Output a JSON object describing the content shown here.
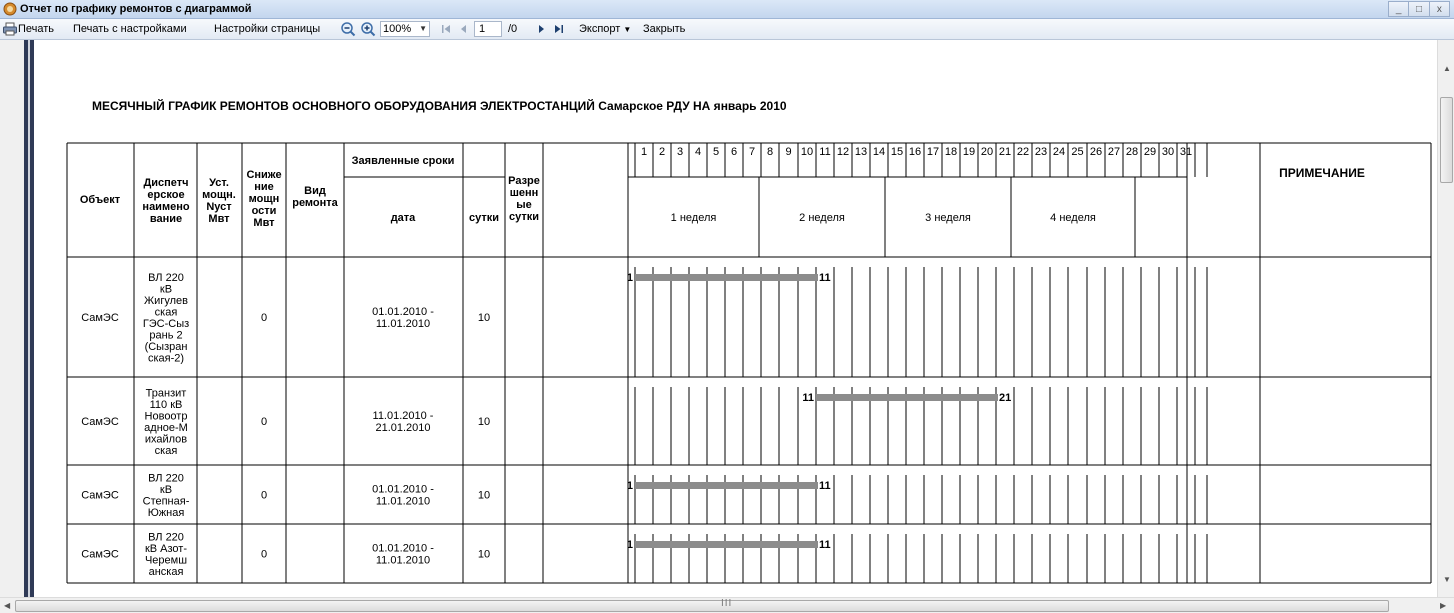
{
  "window": {
    "title": "Отчет по графику ремонтов с диаграммой",
    "controls": [
      "_",
      "□",
      "x"
    ]
  },
  "toolbar": {
    "print": "Печать",
    "print_settings": "Печать с настройками",
    "page_settings": "Настройки страницы",
    "zoom": "100%",
    "page": "1",
    "page_total": "/0",
    "export": "Экспорт",
    "close": "Закрыть",
    "icons": [
      "print-icon",
      "zoom-out-icon",
      "zoom-in-icon",
      "first-page-icon",
      "prev-page-icon",
      "next-page-icon",
      "last-page-icon"
    ]
  },
  "report": {
    "title": "МЕСЯЧНЫЙ ГРАФИК РЕМОНТОВ ОСНОВНОГО ОБОРУДОВАНИЯ ЭЛЕКТРОСТАНЦИЙ Самарское РДУ НА  январь 2010",
    "headers": {
      "object": "Объект",
      "dispatch_name": [
        "Диспетч",
        "ерское",
        "наимено",
        "вание"
      ],
      "capacity": [
        "Уст.",
        "мощн.",
        "Nуст",
        "Мвт"
      ],
      "reduction": [
        "Сниже",
        "ние",
        "мощн",
        "ости",
        "Мвт"
      ],
      "repair_type": [
        "Вид",
        "ремонта"
      ],
      "declared_terms": "Заявленные сроки",
      "date": "дата",
      "days": "сутки",
      "allowed": [
        "Разре",
        "шенн",
        "ые",
        "сутки"
      ],
      "note": "ПРИМЕЧАНИЕ"
    },
    "days": [
      "1",
      "2",
      "3",
      "4",
      "5",
      "6",
      "7",
      "8",
      "9",
      "10",
      "11",
      "12",
      "13",
      "14",
      "15",
      "16",
      "17",
      "18",
      "19",
      "20",
      "21",
      "22",
      "23",
      "24",
      "25",
      "26",
      "27",
      "28",
      "29",
      "30",
      "31"
    ],
    "weeks": [
      "1 неделя",
      "2 неделя",
      "3 неделя",
      "4 неделя"
    ],
    "rows": [
      {
        "object": "СамЭС",
        "name": [
          "ВЛ 220",
          "кВ",
          "Жигулев",
          "ская",
          "ГЭС-Сыз",
          "рань 2",
          "(Сызран",
          "ская-2)"
        ],
        "capacity": "",
        "reduction": "0",
        "repair_type": "",
        "date": [
          "01.01.2010 -",
          "11.01.2010"
        ],
        "days": "10",
        "allowed": "",
        "start": 1,
        "end": 11,
        "start_label": "1",
        "end_label": "11"
      },
      {
        "object": "СамЭС",
        "name": [
          "Транзит",
          "110 кВ",
          "Новоотр",
          "адное-М",
          "ихайлов",
          "ская"
        ],
        "capacity": "",
        "reduction": "0",
        "repair_type": "",
        "date": [
          "11.01.2010 -",
          "21.01.2010"
        ],
        "days": "10",
        "allowed": "",
        "start": 11,
        "end": 21,
        "start_label": "11",
        "end_label": "21"
      },
      {
        "object": "СамЭС",
        "name": [
          "ВЛ 220",
          "кВ",
          "Степная-",
          "Южная"
        ],
        "capacity": "",
        "reduction": "0",
        "repair_type": "",
        "date": [
          "01.01.2010 -",
          "11.01.2010"
        ],
        "days": "10",
        "allowed": "",
        "start": 1,
        "end": 11,
        "start_label": "1",
        "end_label": "11"
      },
      {
        "object": "СамЭС",
        "name": [
          "ВЛ 220",
          "кВ Азот-",
          "Черемш",
          "анская"
        ],
        "capacity": "",
        "reduction": "0",
        "repair_type": "",
        "date": [
          "01.01.2010 -",
          "11.01.2010"
        ],
        "days": "10",
        "allowed": "",
        "start": 1,
        "end": 11,
        "start_label": "1",
        "end_label": "11"
      }
    ]
  },
  "scrollbar": {
    "grip": "III"
  },
  "colors": {
    "bar": "#8c8c8c",
    "leftbar": "#2f3a57",
    "grid": "#000000"
  }
}
